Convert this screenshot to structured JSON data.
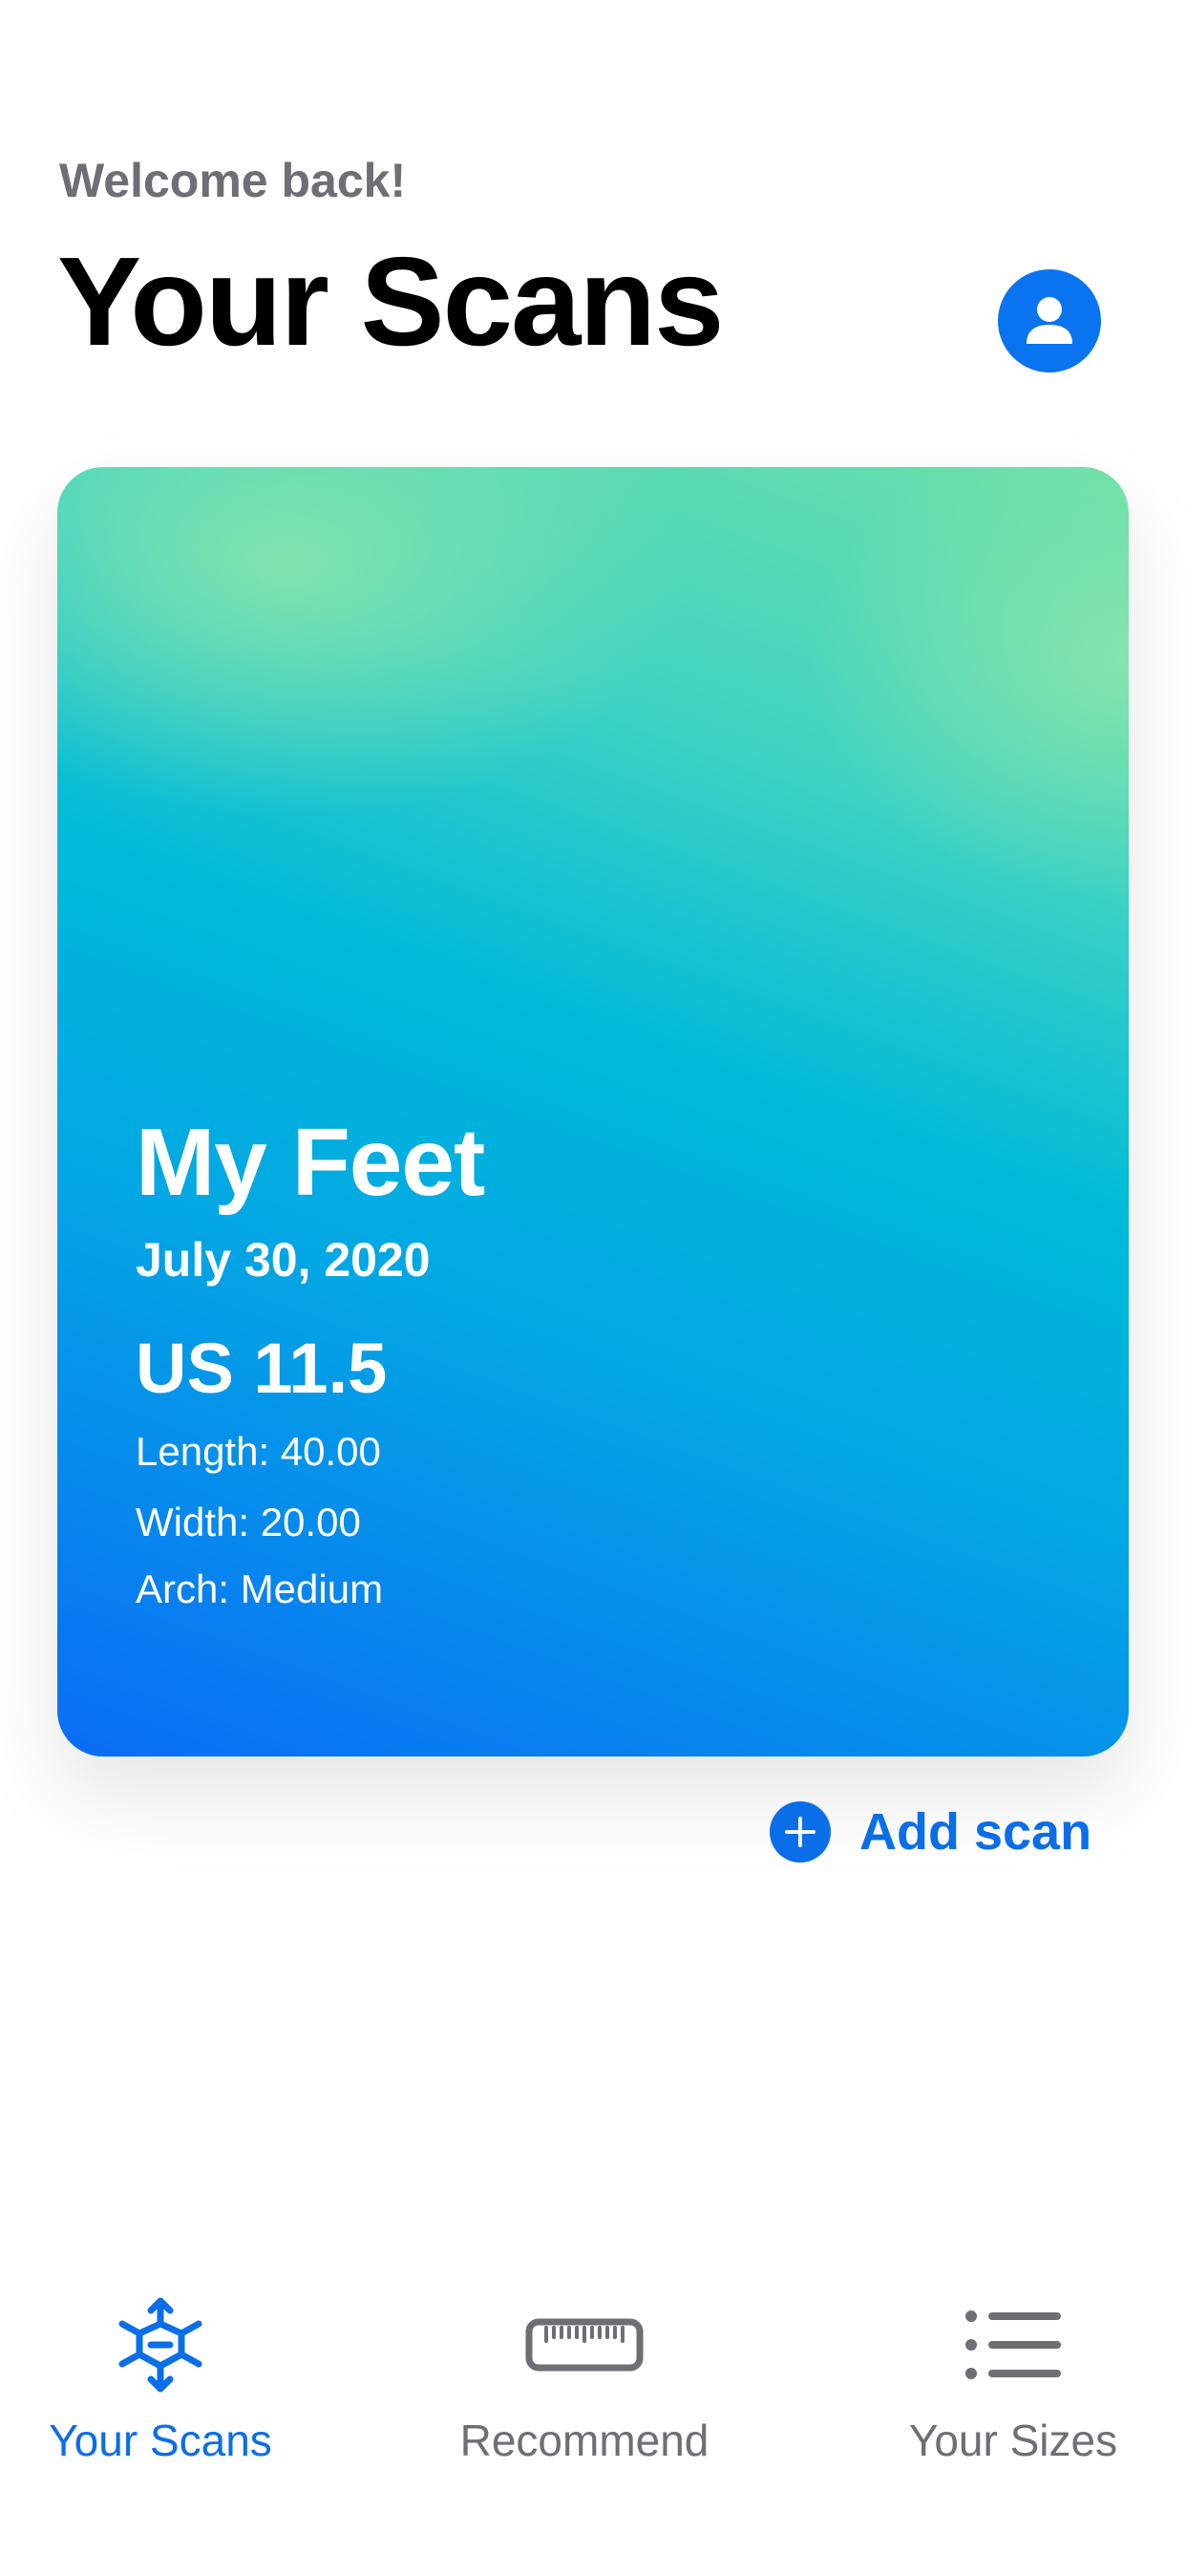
{
  "header": {
    "welcome": "Welcome back!",
    "title": "Your Scans",
    "profile_icon": "person-circle-icon"
  },
  "scan_card": {
    "name": "My Feet",
    "date": "July 30, 2020",
    "size": "US 11.5",
    "length": "Length: 40.00",
    "width": "Width: 20.00",
    "arch": "Arch: Medium"
  },
  "add_scan": {
    "label": "Add scan",
    "icon": "plus-circle-icon"
  },
  "tabbar": {
    "tabs": [
      {
        "label": "Your Scans",
        "icon": "scan-cube-icon",
        "active": true
      },
      {
        "label": "Recommend",
        "icon": "ruler-icon",
        "active": false
      },
      {
        "label": "Your Sizes",
        "icon": "list-icon",
        "active": false
      }
    ]
  },
  "colors": {
    "accent": "#0a6ee8",
    "secondary_text": "#6e6e73",
    "card_gradient_top": "#6ee0a8",
    "card_gradient_bottom": "#0a6cf5"
  }
}
